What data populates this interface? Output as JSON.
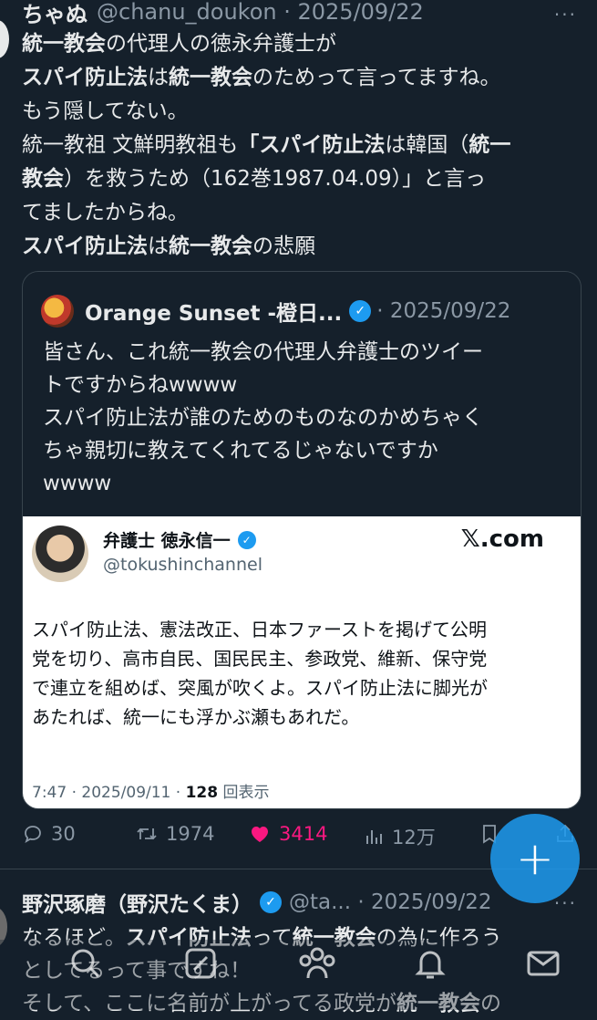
{
  "post1": {
    "display_name": "ちゃぬ",
    "handle_date": "@chanu_doukon · 2025/09/22",
    "more": "···",
    "body_lines": [
      [
        {
          "t": "統一教会",
          "b": true
        },
        {
          "t": "の代理人の徳永弁護士が",
          "b": false
        }
      ],
      [
        {
          "t": "スパイ防止法",
          "b": true
        },
        {
          "t": "は",
          "b": false
        },
        {
          "t": "統一教会",
          "b": true
        },
        {
          "t": "のためって言ってますね。",
          "b": false
        }
      ],
      [
        {
          "t": "もう隠してない。",
          "b": false
        }
      ],
      [
        {
          "t": "統一教祖 文鮮明教祖も",
          "b": false
        },
        {
          "t": "「スパイ防止法",
          "b": true
        },
        {
          "t": "は韓国（",
          "b": false
        },
        {
          "t": "統一",
          "b": true
        }
      ],
      [
        {
          "t": "教会",
          "b": true
        },
        {
          "t": "）を救うため（162巻1987.04.09）」と言っ",
          "b": false
        }
      ],
      [
        {
          "t": "てましたからね。",
          "b": false
        }
      ],
      [
        {
          "t": "スパイ防止法",
          "b": true
        },
        {
          "t": "は",
          "b": false
        },
        {
          "t": "統一教会",
          "b": true
        },
        {
          "t": "の悲願",
          "b": false
        }
      ]
    ]
  },
  "quote": {
    "name": "Orange Sunset -橙日...",
    "date": "· 2025/09/22",
    "verified_mark": "✓",
    "lines": [
      "皆さん、これ統一教会の代理人弁護士のツイー",
      "トですからねwwww",
      "スパイ防止法が誰のためのものなのかめちゃく",
      "ちゃ親切に教えてくれてるじゃないですか",
      "wwww"
    ],
    "card": {
      "name": "弁護士 徳永信一",
      "handle": "@tokushinchannel",
      "xcom": "𝕏.com",
      "text_lines": [
        "スパイ防止法、憲法改正、日本ファーストを掲げて公明",
        "党を切り、高市自民、国民民主、参政党、維新、保守党",
        "で連立を組めば、突風が吹くよ。スパイ防止法に脚光が",
        "あたれば、統一にも浮かぶ瀬もあれだ。"
      ],
      "meta_prefix": "7:47 · 2025/09/11 · ",
      "views": "128",
      "views_suffix": " 回表示"
    }
  },
  "actions": {
    "replies": "30",
    "reposts": "1974",
    "likes": "3414",
    "views": "12万"
  },
  "post2": {
    "display_name": "野沢琢磨（野沢たくま）",
    "handle_date": "@ta... · 2025/09/22",
    "more": "···",
    "body_lines": [
      [
        {
          "t": "なるほど。",
          "b": false
        },
        {
          "t": "スパイ防止法",
          "b": true
        },
        {
          "t": "って",
          "b": false
        },
        {
          "t": "統一教会",
          "b": true
        },
        {
          "t": "の為に作ろう",
          "b": false
        }
      ],
      [
        {
          "t": "としてるって事ですね！",
          "b": false
        }
      ],
      [
        {
          "t": "そして、ここに名前が上がってる政党が",
          "b": false
        },
        {
          "t": "統一教会",
          "b": true
        },
        {
          "t": "の",
          "b": false
        }
      ]
    ]
  },
  "fab_label": "+",
  "colors": {
    "accent": "#1d9bf0",
    "like": "#f91880",
    "bg": "#15202b",
    "muted": "#8b98a5"
  }
}
